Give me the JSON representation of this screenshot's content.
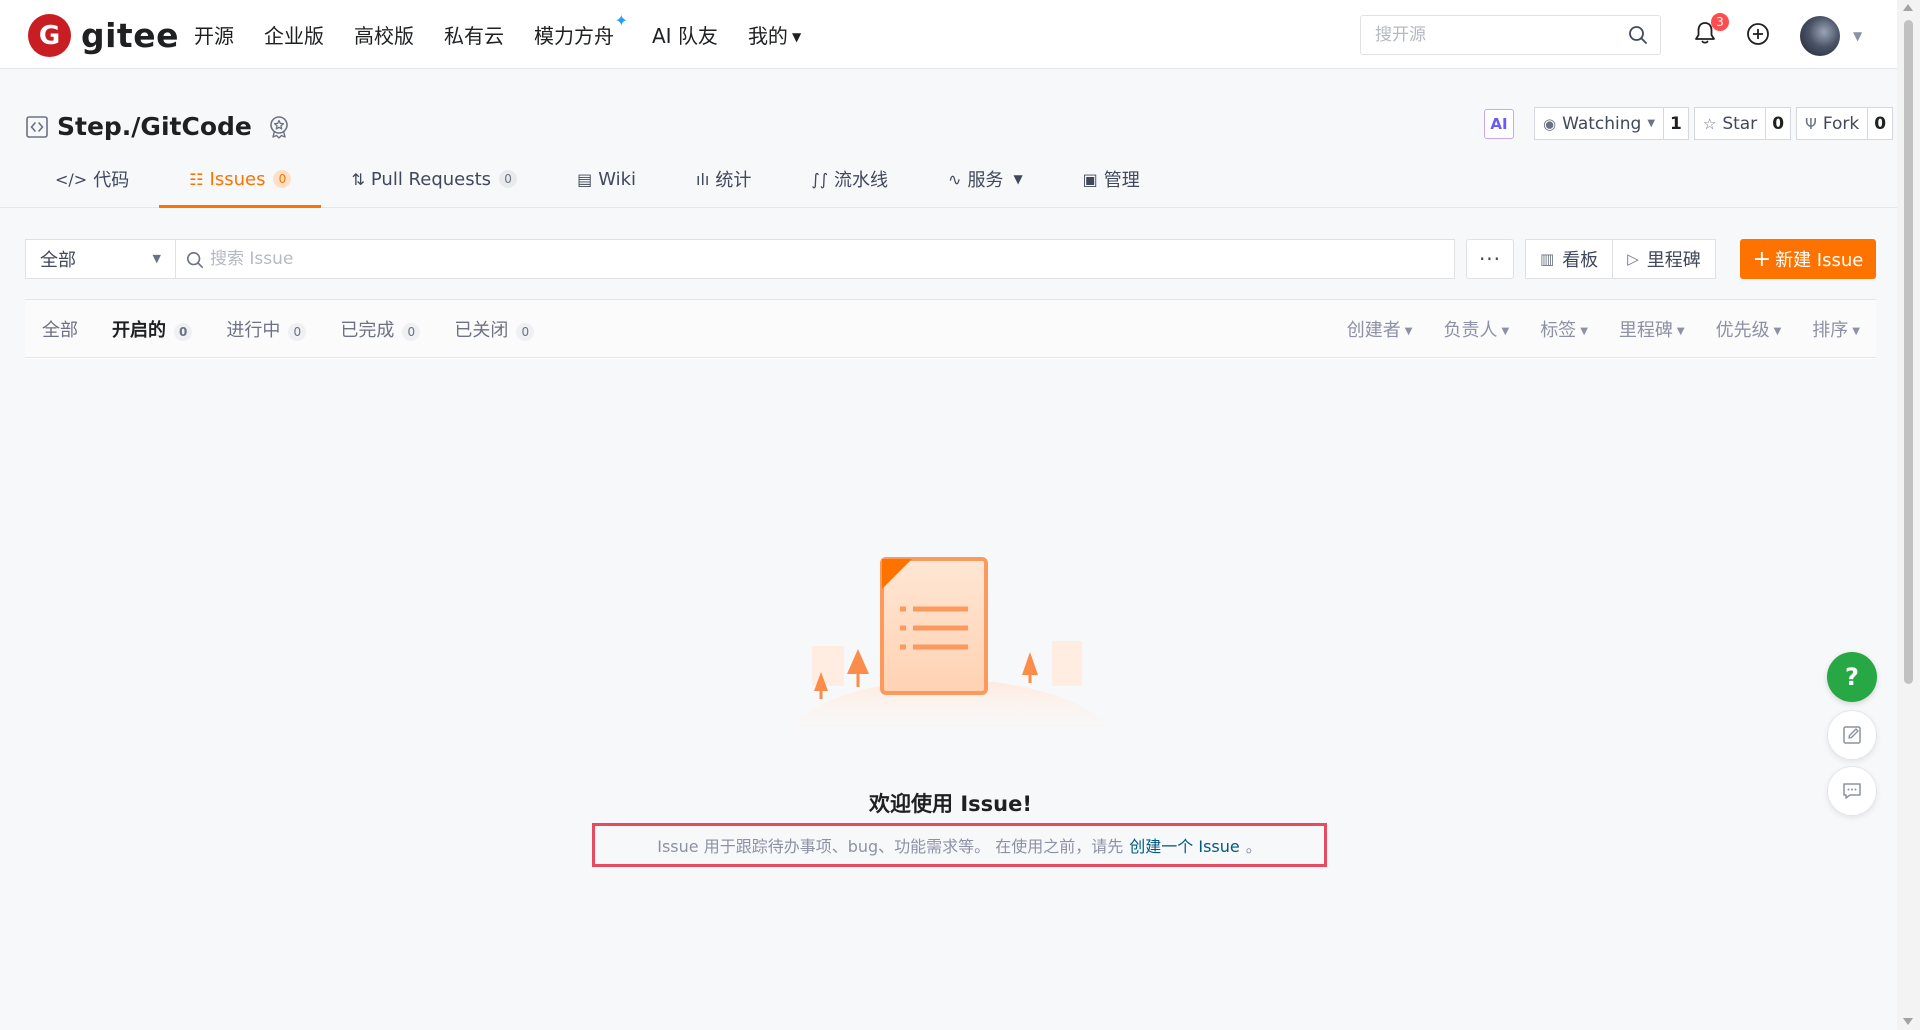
{
  "nav": {
    "logo_text": "gitee",
    "logo_mark": "G",
    "links": [
      "开源",
      "企业版",
      "高校版",
      "私有云",
      "模力方舟",
      "AI 队友",
      "我的"
    ],
    "sparkle": "✦",
    "search_placeholder": "搜开源",
    "notification_count": "3",
    "icons": [
      "search-icon",
      "bell-icon",
      "plus-circle-icon",
      "avatar",
      "chevron-down-icon"
    ]
  },
  "repo": {
    "name": "Step./GitCode",
    "ai_label": "AI",
    "watch": {
      "label": "Watching",
      "count": "1"
    },
    "star": {
      "label": "Star",
      "count": "0"
    },
    "fork": {
      "label": "Fork",
      "count": "0"
    }
  },
  "tabs": [
    {
      "icon": "</>",
      "label": "代码",
      "count": null
    },
    {
      "icon": "☷",
      "label": "Issues",
      "count": "0"
    },
    {
      "icon": "⇅",
      "label": "Pull Requests",
      "count": "0"
    },
    {
      "icon": "▤",
      "label": "Wiki",
      "count": null
    },
    {
      "icon": "ılı",
      "label": "统计",
      "count": null
    },
    {
      "icon": "∫∫",
      "label": "流水线",
      "count": null
    },
    {
      "icon": "∿",
      "label": "服务",
      "count": null
    },
    {
      "icon": "▣",
      "label": "管理",
      "count": null
    }
  ],
  "toolbar": {
    "scope_select": "全部",
    "search_placeholder": "搜索 Issue",
    "more": "···",
    "board_label": "看板",
    "milestone_label": "里程碑",
    "new_issue_label": "新建 Issue",
    "new_issue_plus": "+"
  },
  "status_tabs": [
    {
      "label": "全部",
      "count": null
    },
    {
      "label": "开启的",
      "count": "0"
    },
    {
      "label": "进行中",
      "count": "0"
    },
    {
      "label": "已完成",
      "count": "0"
    },
    {
      "label": "已关闭",
      "count": "0"
    }
  ],
  "filters": [
    "创建者",
    "负责人",
    "标签",
    "里程碑",
    "优先级",
    "排序"
  ],
  "empty": {
    "title": "欢迎使用 Issue!",
    "hint_prefix": "Issue 用于跟踪待办事项、bug、功能需求等。 在使用之前，请先",
    "hint_link": "创建一个 Issue",
    "hint_suffix": "。"
  },
  "float": {
    "help_label": "?"
  },
  "colors": {
    "accent": "#fe7300",
    "help_green": "#28a745",
    "highlight_border": "#e84a5f",
    "link": "#005980"
  }
}
